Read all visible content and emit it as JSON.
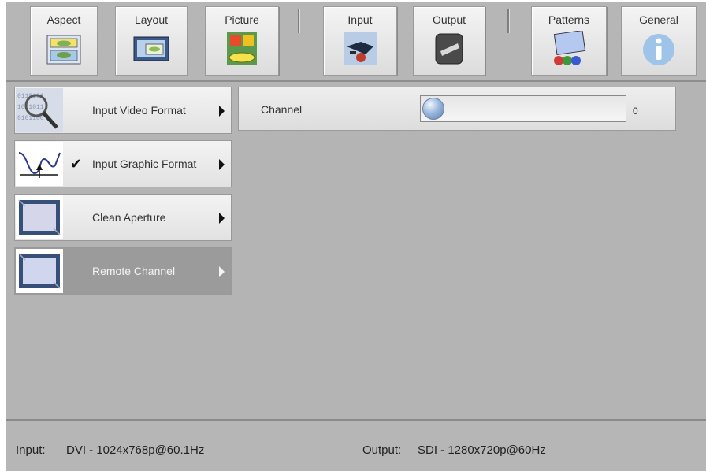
{
  "toolbar": {
    "buttons": [
      {
        "label": "Aspect",
        "icon": "aspect-icon"
      },
      {
        "label": "Layout",
        "icon": "layout-icon"
      },
      {
        "label": "Picture",
        "icon": "picture-icon"
      },
      {
        "label": "Input",
        "icon": "input-icon"
      },
      {
        "label": "Output",
        "icon": "output-icon"
      },
      {
        "label": "Patterns",
        "icon": "patterns-icon"
      },
      {
        "label": "General",
        "icon": "info-icon"
      }
    ]
  },
  "menu": {
    "items": [
      {
        "label": "Input Video Format",
        "icon": "magnifier-icon",
        "checked": false,
        "selected": false
      },
      {
        "label": "Input Graphic Format",
        "icon": "waveform-icon",
        "checked": true,
        "selected": false
      },
      {
        "label": "Clean Aperture",
        "icon": "frame-icon",
        "checked": false,
        "selected": false
      },
      {
        "label": "Remote Channel",
        "icon": "frame-icon",
        "checked": false,
        "selected": true
      }
    ],
    "check_glyph": "✔"
  },
  "channel": {
    "label": "Channel",
    "value": "0",
    "level": 0
  },
  "status": {
    "input_label": "Input:",
    "input_value": "DVI - 1024x768p@60.1Hz",
    "output_label": "Output:",
    "output_value": "SDI - 1280x720p@60Hz"
  },
  "colors": {
    "background": "#b4b4b4",
    "selected_item": "#9b9b9b",
    "knob": "#9cb8dd"
  }
}
